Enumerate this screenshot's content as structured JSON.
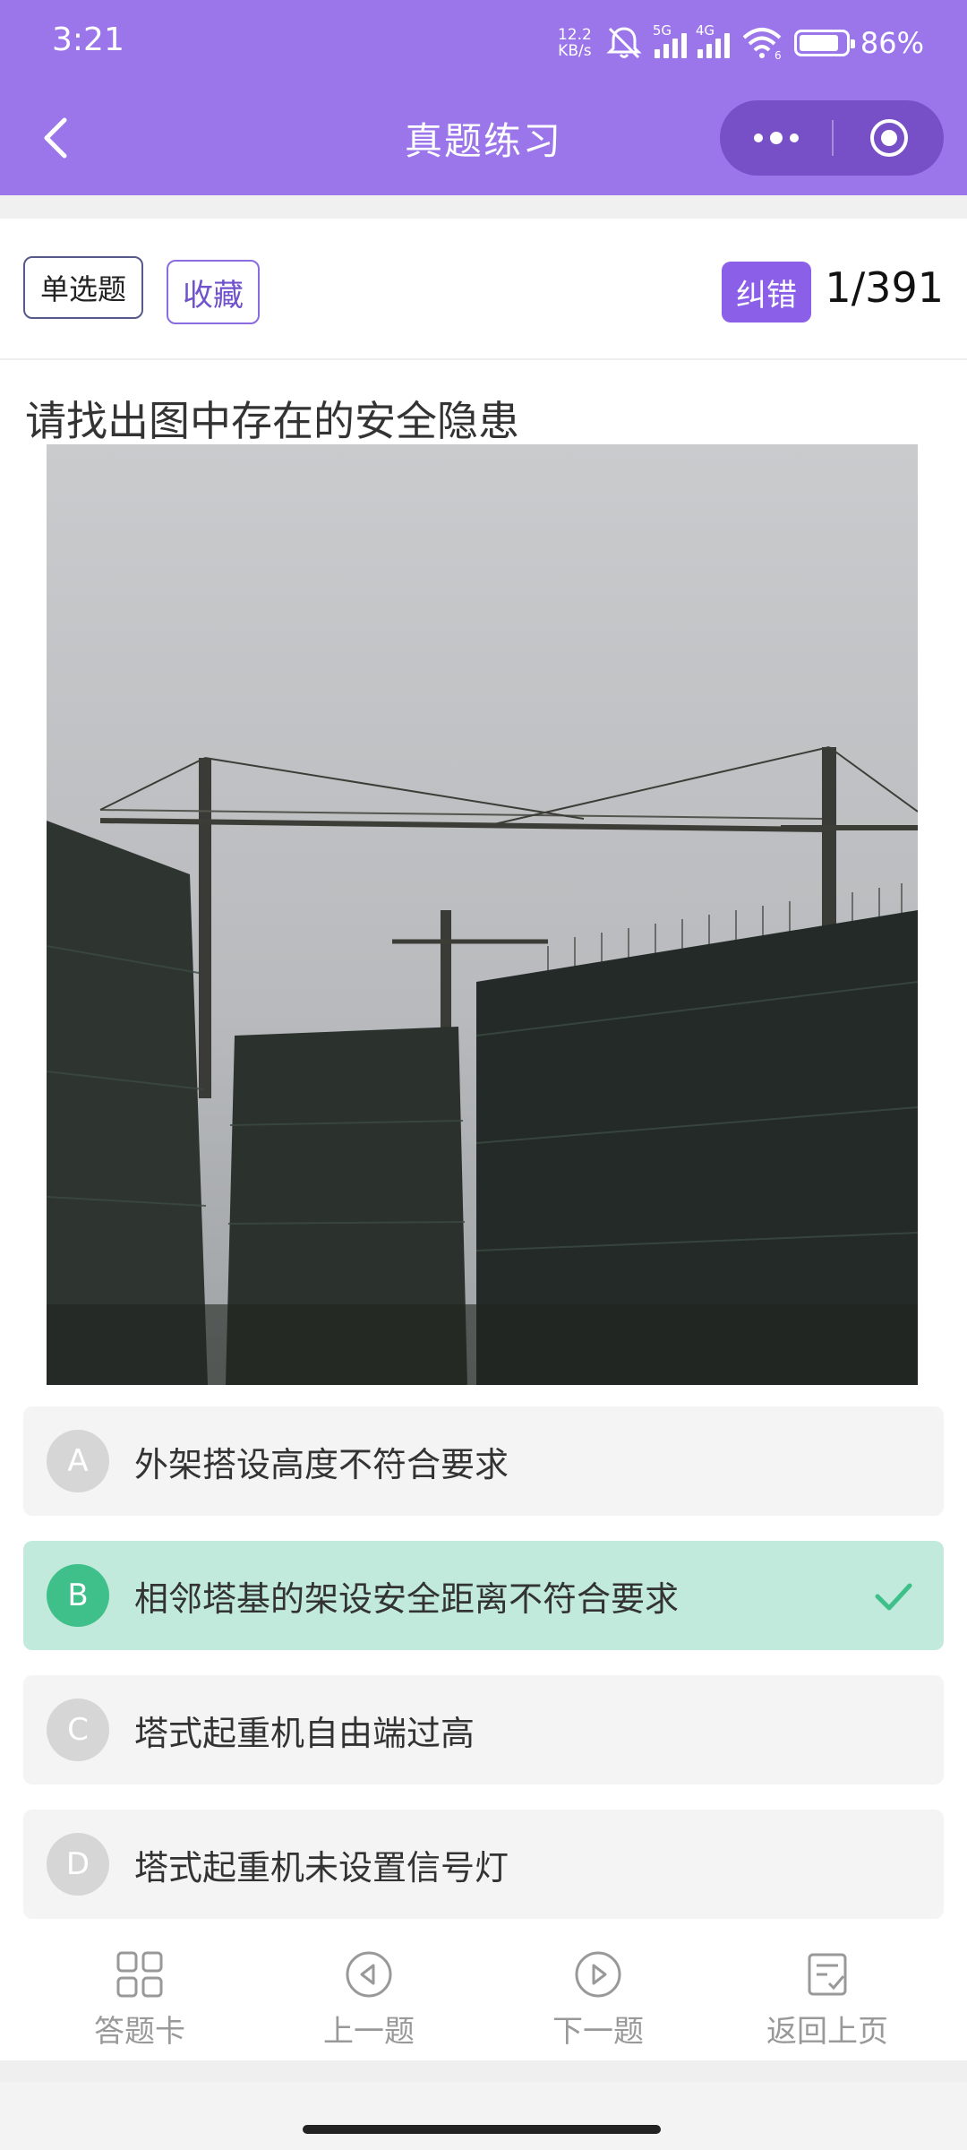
{
  "status_bar": {
    "time": "3:21",
    "net_speed_value": "12.2",
    "net_speed_unit": "KB/s",
    "signal1_tag": "5G",
    "signal2_tag": "4G",
    "wifi_tag": "6",
    "battery_percent": "86%",
    "battery_level": 0.86
  },
  "nav": {
    "title": "真题练习",
    "back_icon": "chevron-left-icon",
    "more_icon": "more-dots-icon",
    "close_icon": "target-circle-icon"
  },
  "question_meta": {
    "type_label": "单选题",
    "favorite_label": "收藏",
    "report_label": "纠错",
    "counter": "1/391"
  },
  "question": {
    "prompt": "请找出图中存在的安全隐患",
    "image": "construction-site-tower-cranes-photo"
  },
  "options": [
    {
      "letter": "A",
      "text": "外架搭设高度不符合要求",
      "correct": false
    },
    {
      "letter": "B",
      "text": "相邻塔基的架设安全距离不符合要求",
      "correct": true
    },
    {
      "letter": "C",
      "text": "塔式起重机自由端过高",
      "correct": false
    },
    {
      "letter": "D",
      "text": "塔式起重机未设置信号灯",
      "correct": false
    }
  ],
  "bottom_nav": {
    "answer_card": "答题卡",
    "prev": "上一题",
    "next": "下一题",
    "back_page": "返回上页"
  },
  "colors": {
    "header_bg": "#9b76ea",
    "accent": "#8b5fe8",
    "correct_bg": "#c2eadc",
    "correct_badge": "#3fc08a"
  }
}
